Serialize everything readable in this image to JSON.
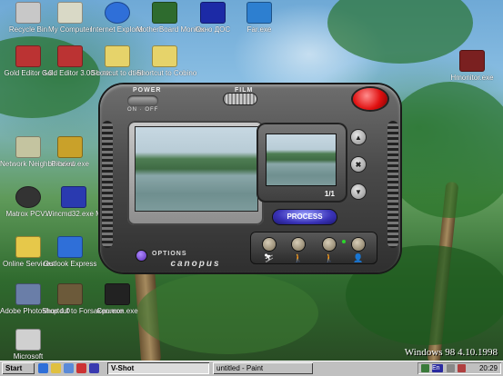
{
  "desktop": {
    "icons": [
      {
        "label": "Recycle Bin"
      },
      {
        "label": "My Computer"
      },
      {
        "label": "Internet Explorer"
      },
      {
        "label": "MotherBoard Monitor"
      },
      {
        "label": "Окно ДОС"
      },
      {
        "label": "Far.exe"
      },
      {
        "label": "Shortcut to dties"
      },
      {
        "label": "Shortcut to Cobino"
      },
      {
        "label": "Gold Editor 3.0"
      },
      {
        "label": "Gold Editor 3.00 с пи..."
      },
      {
        "label": "Hmonitor.exe"
      },
      {
        "label": "Network Neighborhood"
      },
      {
        "label": "Picview.exe"
      },
      {
        "label": "Matrox PCV..."
      },
      {
        "label": "Wincmd32.exe My"
      },
      {
        "label": "Online Services"
      },
      {
        "label": "Outlook Express"
      },
      {
        "label": "Adobe Photoshop 4.0"
      },
      {
        "label": "Shortcut to Forsaken.exe"
      },
      {
        "label": "Cpumon.exe"
      },
      {
        "label": "Microsoft"
      }
    ],
    "os_version": "Windows 98 4.10.1998"
  },
  "vshot": {
    "power_label": "POWER",
    "power_states": "ON · OFF",
    "film_label": "FILM",
    "brand": "canopus",
    "counter": "1/1",
    "process_label": "PROCESS",
    "options_label": "OPTIONS",
    "nav_up": "▲",
    "nav_close": "✖",
    "nav_down": "▼",
    "modes": [
      "⛷",
      "🚶",
      "🚶",
      "👤"
    ]
  },
  "taskbar": {
    "start_label": "Start",
    "windows": [
      {
        "label": "V-Shot",
        "active": true
      },
      {
        "label": "untitled - Paint",
        "active": false
      }
    ],
    "tray_lang": "En",
    "clock": "20:29"
  },
  "colors": {
    "device_body": "#4a4a4a",
    "red_button": "#e01010",
    "process_button": "#3a33b8",
    "taskbar": "#c0c0c0"
  }
}
